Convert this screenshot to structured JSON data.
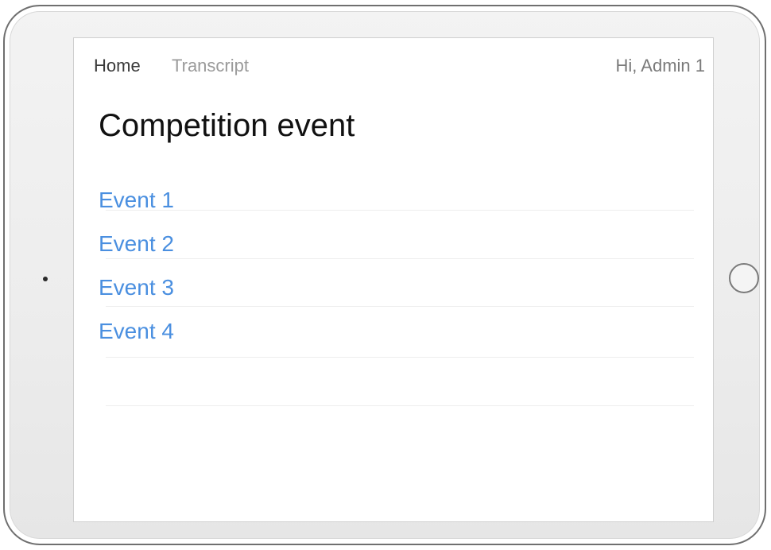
{
  "nav": {
    "home": "Home",
    "transcript": "Transcript",
    "user_greeting": "Hi, Admin 1"
  },
  "page": {
    "title": "Competition event"
  },
  "events": [
    "Event 1",
    "Event 2",
    "Event 3",
    "Event 4"
  ],
  "colors": {
    "link": "#4a8fe0",
    "title": "#111111",
    "nav_active": "#3a3a3a",
    "nav_inactive": "#9a9a9a"
  }
}
